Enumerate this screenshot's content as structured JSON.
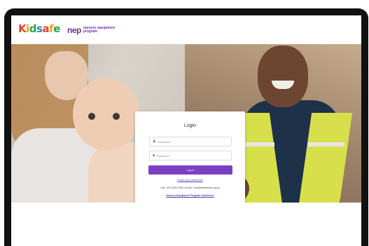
{
  "header": {
    "kids_logo": {
      "letters": [
        "K",
        "i",
        "d",
        "s",
        "a",
        "f",
        "e"
      ],
      "colors": [
        "#e8412c",
        "#f6a21c",
        "#2aa34a",
        "#2f7fc1",
        "#e8412c",
        "#f6a21c",
        "#2aa34a"
      ]
    },
    "nep_logo": {
      "mark": "nep",
      "line1": "nursery equipment",
      "line2": "program"
    }
  },
  "login": {
    "title": "Login",
    "username_placeholder": "Username",
    "password_placeholder": "Password",
    "button_label": "Log in",
    "forgot_link": "Forgot your password?",
    "contact_text": "Call : (02) 9036 3306  |  Email : nep@kidsafensw.org.au",
    "guidelines_link": "Nursery Equipment Program Guidelines"
  },
  "colors": {
    "accent": "#7b3fc4",
    "link": "#5b3ba6",
    "device_frame": "#111111"
  },
  "icons": {
    "username_icon": "user-icon",
    "password_icon": "lock-icon"
  }
}
